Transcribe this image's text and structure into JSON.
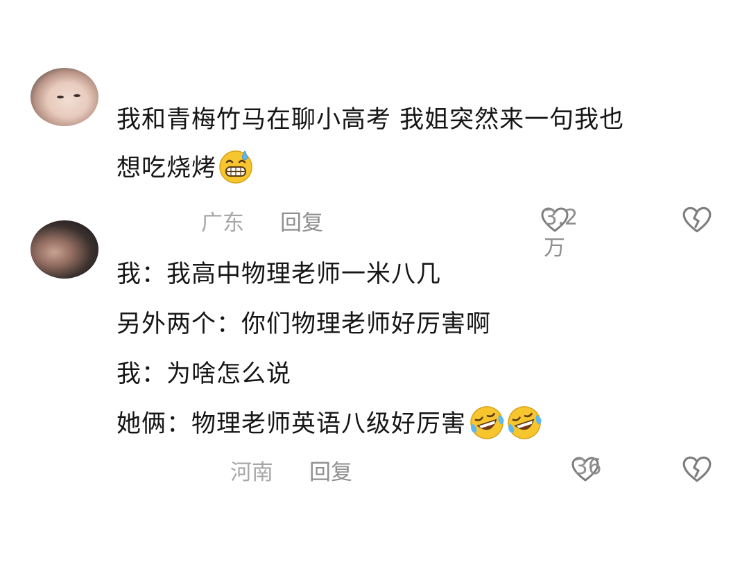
{
  "comments": [
    {
      "lines": [
        "我和青梅竹马在聊小高考 我姐突然来一句我也",
        "想吃烧烤"
      ],
      "emoji": [
        "grimacing-sweat-emoji"
      ],
      "location": "广东",
      "reply_label": "回复",
      "likes": "3.2万"
    },
    {
      "lines": [
        "我：我高中物理老师一米八几",
        "另外两个：你们物理老师好厉害啊",
        "我：为啥怎么说",
        "她俩：物理老师英语八级好厉害"
      ],
      "emoji": [
        "rolling-laughing-emoji",
        "rolling-laughing-emoji"
      ],
      "location": "河南",
      "reply_label": "回复",
      "likes": "36"
    }
  ],
  "colors": {
    "meta_text": "#a7a7a7",
    "icon_stroke": "#7d7d7d",
    "emoji_yellow": "#f7c62f"
  }
}
